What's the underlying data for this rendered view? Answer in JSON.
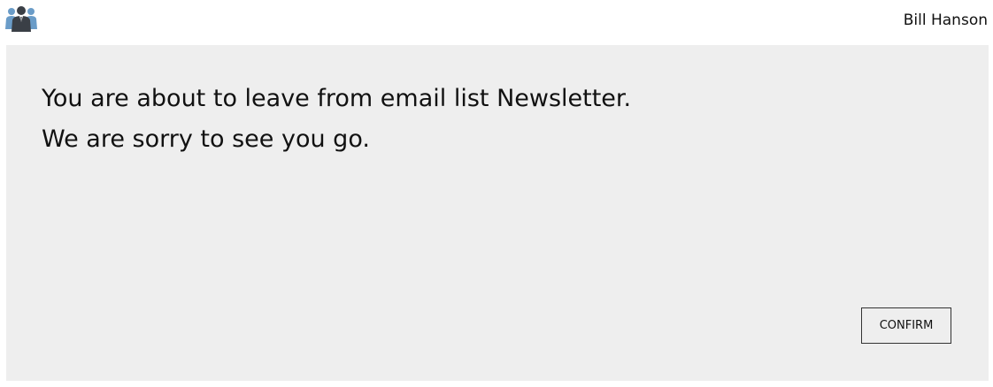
{
  "header": {
    "logo_icon": "users-group-icon",
    "user_name": "Bill Hanson"
  },
  "main": {
    "line1": "You are about to leave from email list Newsletter.",
    "line2": "We are sorry to see you go.",
    "confirm_label": "CONFIRM"
  },
  "colors": {
    "panel_background": "#eeeeee",
    "logo_dark": "#3a3f46",
    "logo_blue": "#6a9cc8"
  }
}
